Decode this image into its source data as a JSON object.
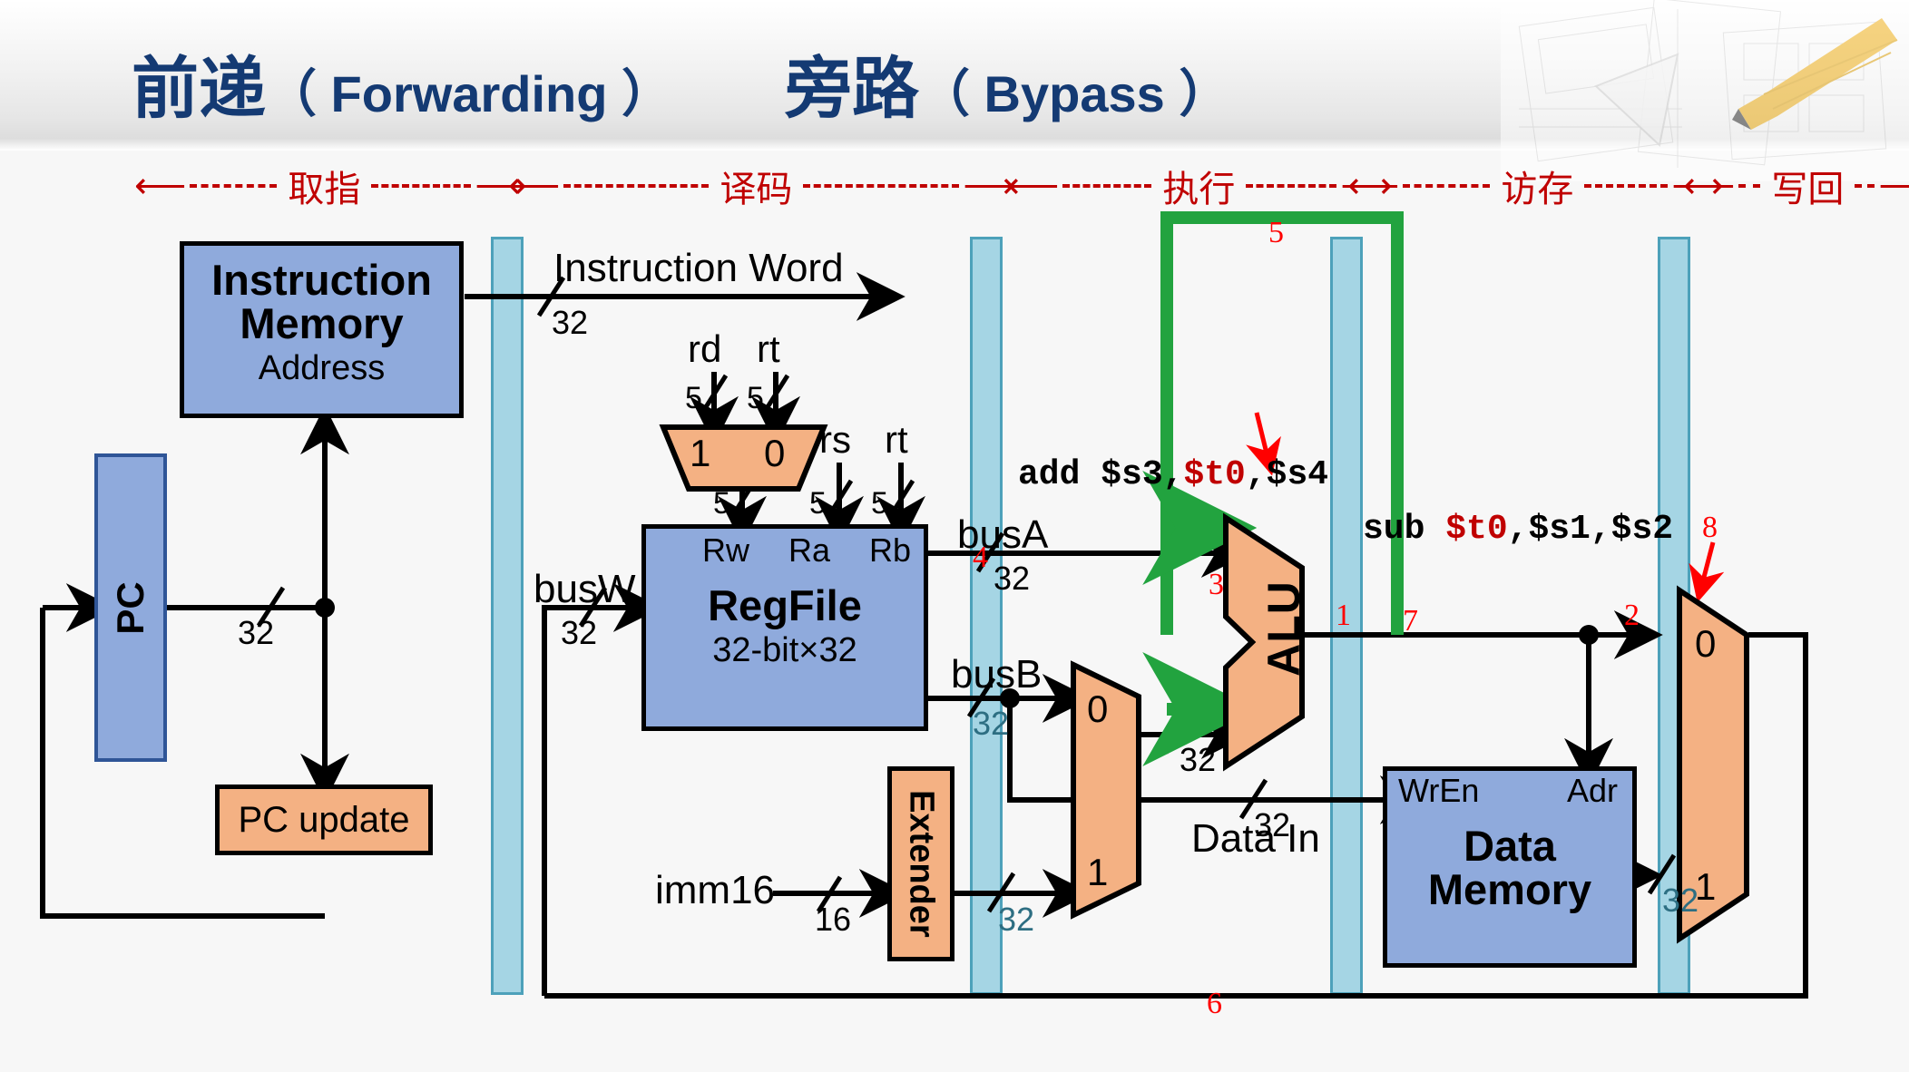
{
  "title": {
    "left_cn": "前递",
    "left_en": "（ Forwarding ）",
    "right_cn": "旁路",
    "right_en": "（ Bypass ）",
    "color": "#143a73"
  },
  "stages": [
    {
      "name": "fetch",
      "label": "取指"
    },
    {
      "name": "decode",
      "label": "译码"
    },
    {
      "name": "execute",
      "label": "执行"
    },
    {
      "name": "memory",
      "label": "访存"
    },
    {
      "name": "writeback",
      "label": "写回"
    }
  ],
  "blocks": {
    "pc": "PC",
    "pc_update": "PC update",
    "instruction_memory_l1": "Instruction",
    "instruction_memory_l2": "Memory",
    "instruction_memory_port": "Address",
    "regfile_l1": "RegFile",
    "regfile_l2": "32-bit×32",
    "regfile_rw": "Rw",
    "regfile_ra": "Ra",
    "regfile_rb": "Rb",
    "extender": "Extender",
    "alu": "ALU",
    "data_memory_l1": "Data",
    "data_memory_l2": "Memory",
    "data_memory_wren": "WrEn",
    "data_memory_adr": "Adr"
  },
  "mux": {
    "rw_top": "1",
    "rw_bottom": "0",
    "busb_top": "0",
    "busb_bottom": "1",
    "wb_top": "0",
    "wb_bottom": "1"
  },
  "signals": {
    "instruction_word": "Instruction Word",
    "busA": "busA",
    "busB": "busB",
    "busW": "busW",
    "imm16": "imm16",
    "data_in": "Data In",
    "rd": "rd",
    "rt_a": "rt",
    "rs": "rs",
    "rt_b": "rt"
  },
  "widths": {
    "w32": "32",
    "w16": "16",
    "w5": "5"
  },
  "instructions": {
    "ex_stage": {
      "text_plain_1": "add $s3,",
      "text_red": "$t0",
      "text_plain_2": ",$s4"
    },
    "mem_stage": {
      "text_plain_1": "sub ",
      "text_red": "$t0",
      "text_plain_2": ",$s1,$s2"
    },
    "red_color": "#c00000"
  },
  "annotations": {
    "n1": "1",
    "n2": "2",
    "n3": "3",
    "n4": "4",
    "n5": "5",
    "n6": "6",
    "n7": "7",
    "n8": "8"
  },
  "colors": {
    "forward_path": "#22a33f",
    "block_blue": "#8faadc",
    "block_orange": "#f4b183",
    "pipeline_reg": "#9fd3e3",
    "stage_label": "#c00000"
  }
}
